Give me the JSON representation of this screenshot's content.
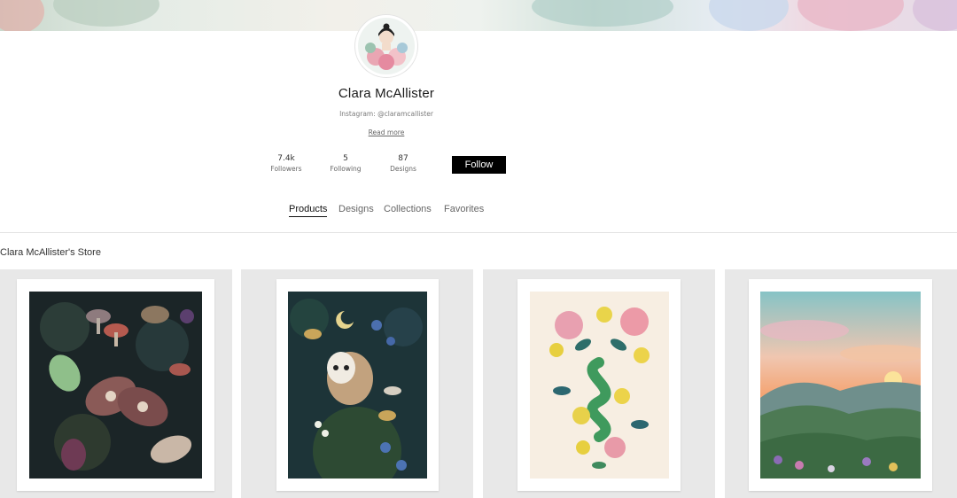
{
  "profile": {
    "name": "Clara McAllister",
    "instagram": "Instagram: @claramcallister",
    "read_more": "Read more"
  },
  "stats": [
    {
      "value": "7.4k",
      "label": "Followers"
    },
    {
      "value": "5",
      "label": "Following"
    },
    {
      "value": "87",
      "label": "Designs"
    }
  ],
  "follow_label": "Follow",
  "tabs": [
    {
      "label": "Products",
      "active": true
    },
    {
      "label": "Designs",
      "active": false
    },
    {
      "label": "Collections",
      "active": false
    },
    {
      "label": "Favorites",
      "active": false
    }
  ],
  "store_title": "Clara McAllister's Store",
  "products": [
    {
      "subject": "moths-and-mushrooms",
      "palette": "#1e2a2c"
    },
    {
      "subject": "barn-owl",
      "palette": "#1f3a3e"
    },
    {
      "subject": "floral-serpent",
      "palette": "#f5ece0"
    },
    {
      "subject": "sunset-landscape",
      "palette": "#f2b58a"
    }
  ]
}
